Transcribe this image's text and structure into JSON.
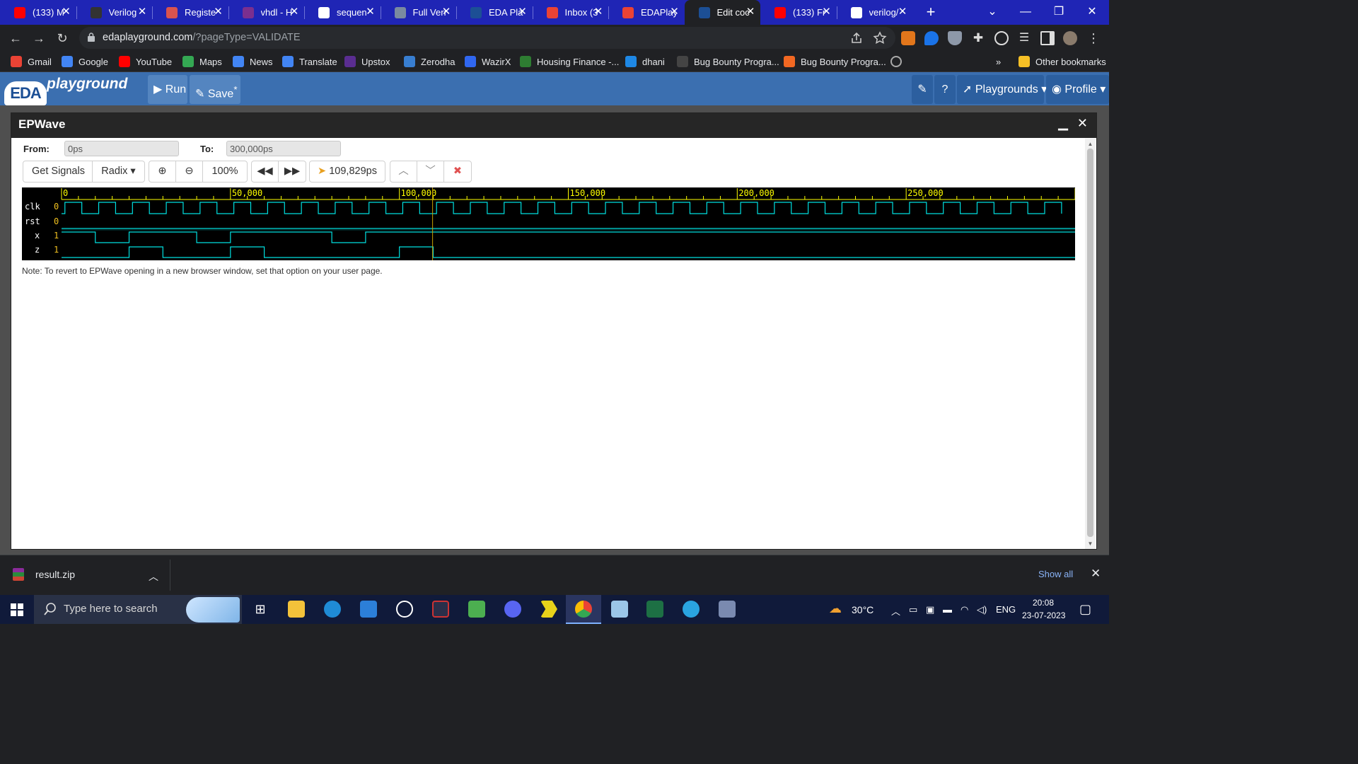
{
  "browser": {
    "tabs": [
      {
        "title": "(133) M",
        "icon": "youtube-icon",
        "color": "#ff0000"
      },
      {
        "title": "Verilog",
        "icon": "chip-icon",
        "color": "#333333"
      },
      {
        "title": "Registe",
        "icon": "chip-icon",
        "color": "#d9534f"
      },
      {
        "title": "vhdl - H",
        "icon": "stackexchange-icon",
        "color": "#7b2f8f"
      },
      {
        "title": "sequen",
        "icon": "google-icon",
        "color": "#ffffff"
      },
      {
        "title": "Full Veri",
        "icon": "doc-icon",
        "color": "#7a8aa0"
      },
      {
        "title": "EDA Pla",
        "icon": "eda-icon",
        "color": "#1c4f95"
      },
      {
        "title": "Inbox (3",
        "icon": "gmail-icon",
        "color": "#ea4335"
      },
      {
        "title": "EDAPlay",
        "icon": "gmail-icon",
        "color": "#ea4335"
      },
      {
        "title": "Edit coc",
        "icon": "eda-icon",
        "color": "#1c4f95",
        "active": true
      },
      {
        "title": "(133) Fr",
        "icon": "youtube-icon",
        "color": "#ff0000"
      },
      {
        "title": "verilog/",
        "icon": "github-icon",
        "color": "#ffffff"
      }
    ],
    "url_host": "edaplayground.com",
    "url_path": "/?pageType=VALIDATE",
    "bookmarks": [
      {
        "label": "Gmail",
        "icon": "gmail-icon",
        "color": "#ea4335"
      },
      {
        "label": "Google",
        "icon": "google-icon",
        "color": "#4285f4"
      },
      {
        "label": "YouTube",
        "icon": "youtube-icon",
        "color": "#ff0000"
      },
      {
        "label": "Maps",
        "icon": "maps-icon",
        "color": "#34a853"
      },
      {
        "label": "News",
        "icon": "news-icon",
        "color": "#4285f4"
      },
      {
        "label": "Translate",
        "icon": "translate-icon",
        "color": "#4285f4"
      },
      {
        "label": "Upstox",
        "icon": "upstox-icon",
        "color": "#5a2d91"
      },
      {
        "label": "Zerodha",
        "icon": "zerodha-icon",
        "color": "#387ed1"
      },
      {
        "label": "WazirX",
        "icon": "wazirx-icon",
        "color": "#3067f0"
      },
      {
        "label": "Housing Finance -...",
        "icon": "housing-icon",
        "color": "#2e7d32"
      },
      {
        "label": "dhani",
        "icon": "dhani-icon",
        "color": "#1e88e5"
      },
      {
        "label": "Bug Bounty Progra...",
        "icon": "hackerone-icon",
        "color": "#444444"
      },
      {
        "label": "Bug Bounty Progra...",
        "icon": "bugcrowd-icon",
        "color": "#f26822"
      }
    ],
    "bookmarks_overflow": "»",
    "other_bookmarks": "Other bookmarks"
  },
  "eda": {
    "logo_badge": "EDA",
    "logo_text": "playground",
    "run_label": "Run",
    "save_label": "Save",
    "save_mark": "*",
    "playgrounds_label": "Playgrounds",
    "profile_label": "Profile"
  },
  "epwave": {
    "title": "EPWave",
    "from_label": "From:",
    "from_value": "0ps",
    "to_label": "To:",
    "to_value": "300,000ps",
    "get_signals": "Get Signals",
    "radix": "Radix",
    "zoom": "100%",
    "cursor_time": "109,829ps",
    "note": "Note: To revert to EPWave opening in a new browser window, set that option on your user page."
  },
  "waveform": {
    "time_range_ps": [
      0,
      300000
    ],
    "cursor_ps": 109829,
    "ruler_labels": [
      "0",
      "50,000",
      "100,000",
      "150,000",
      "200,000",
      "250,000"
    ],
    "ruler_values_ps": [
      0,
      50000,
      100000,
      150000,
      200000,
      250000
    ],
    "clock_period_ps": 10000,
    "signals": [
      {
        "name": "clk",
        "value": "0"
      },
      {
        "name": "rst",
        "value": "0"
      },
      {
        "name": "x",
        "value": "1"
      },
      {
        "name": "z",
        "value": "1"
      }
    ],
    "transitions_ps": {
      "x": [
        [
          0,
          1
        ],
        [
          10000,
          0
        ],
        [
          20000,
          1
        ],
        [
          40000,
          0
        ],
        [
          50000,
          1
        ],
        [
          80000,
          0
        ],
        [
          90000,
          1
        ],
        [
          100000,
          1
        ]
      ],
      "z": [
        [
          0,
          0
        ],
        [
          20000,
          1
        ],
        [
          30000,
          0
        ],
        [
          50000,
          1
        ],
        [
          60000,
          0
        ],
        [
          100000,
          1
        ],
        [
          110000,
          0
        ]
      ]
    },
    "trace_color": "#00e0e0",
    "ruler_color": "#ffff00",
    "cursor_color": "#c8a000"
  },
  "downloads": {
    "file": "result.zip",
    "show_all": "Show all"
  },
  "taskbar": {
    "search_placeholder": "Type here to search",
    "temperature": "30°C",
    "language": "ENG",
    "time": "20:08",
    "date": "23-07-2023"
  }
}
